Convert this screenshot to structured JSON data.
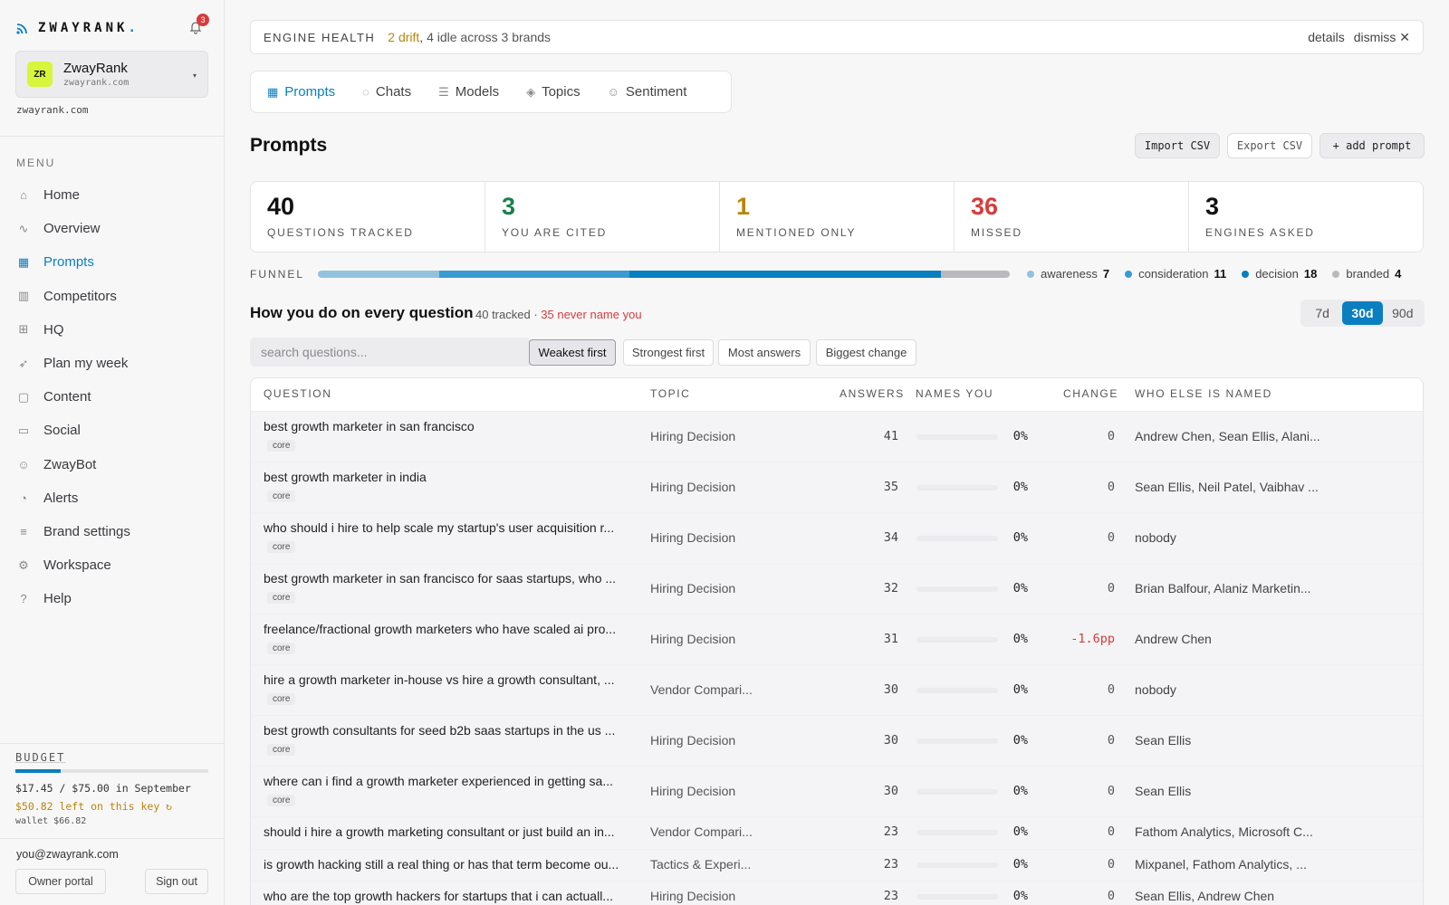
{
  "app": {
    "logo_text": "ZWAYRANK",
    "logo_dot": ".",
    "notifications_count": "3"
  },
  "brand": {
    "initials": "ZR",
    "name": "ZwayRank",
    "domain": "zwayrank.com",
    "domain_under": "zwayrank.com",
    "caret": "▾"
  },
  "sidebar": {
    "menu_label": "MENU",
    "items": [
      {
        "label": "Home",
        "icon": "home-icon",
        "glyph": "⌂"
      },
      {
        "label": "Overview",
        "icon": "pulse-icon",
        "glyph": "∿"
      },
      {
        "label": "Prompts",
        "icon": "grid-icon",
        "glyph": "▦"
      },
      {
        "label": "Competitors",
        "icon": "bar-chart-icon",
        "glyph": "▥"
      },
      {
        "label": "HQ",
        "icon": "dashboard-icon",
        "glyph": "⊞"
      },
      {
        "label": "Plan my week",
        "icon": "rocket-icon",
        "glyph": "➶"
      },
      {
        "label": "Content",
        "icon": "document-icon",
        "glyph": "▢"
      },
      {
        "label": "Social",
        "icon": "chat-icon",
        "glyph": "▭"
      },
      {
        "label": "ZwayBot",
        "icon": "bot-icon",
        "glyph": "☺"
      },
      {
        "label": "Alerts",
        "icon": "bell-icon",
        "glyph": "◔"
      },
      {
        "label": "Brand settings",
        "icon": "sliders-icon",
        "glyph": "≡"
      },
      {
        "label": "Workspace",
        "icon": "gear-icon",
        "glyph": "⚙"
      },
      {
        "label": "Help",
        "icon": "help-icon",
        "glyph": "?"
      }
    ],
    "active_index": 2
  },
  "budget": {
    "label": "BUDGET",
    "spent_fraction": 0.233,
    "line1": "$17.45 / $75.00 in September",
    "line2": "$50.82 left on this key ↻",
    "line3": "wallet $66.82"
  },
  "account": {
    "email": "you@zwayrank.com",
    "owner_portal": "Owner portal",
    "sign_out": "Sign out"
  },
  "health": {
    "label": "ENGINE HEALTH",
    "drift": "2 drift",
    "rest": ", 4 idle across 3 brands",
    "details": "details",
    "dismiss": "dismiss"
  },
  "tabs": [
    {
      "label": "Prompts",
      "icon": "grid-icon",
      "glyph": "▦"
    },
    {
      "label": "Chats",
      "icon": "chat-icon",
      "glyph": "◌"
    },
    {
      "label": "Models",
      "icon": "list-icon",
      "glyph": "☰"
    },
    {
      "label": "Topics",
      "icon": "layers-icon",
      "glyph": "◈"
    },
    {
      "label": "Sentiment",
      "icon": "smile-icon",
      "glyph": "☺"
    }
  ],
  "page": {
    "title": "Prompts",
    "import_csv": "Import CSV",
    "export_csv": "Export CSV",
    "add_prompt": "+ add prompt"
  },
  "stats": [
    {
      "value": "40",
      "label": "QUESTIONS TRACKED",
      "color": "#111111"
    },
    {
      "value": "3",
      "label": "YOU ARE CITED",
      "color": "#1a7f4e"
    },
    {
      "value": "1",
      "label": "MENTIONED ONLY",
      "color": "#b8860b"
    },
    {
      "value": "36",
      "label": "MISSED",
      "color": "#d83b3b"
    },
    {
      "value": "3",
      "label": "ENGINES ASKED",
      "color": "#111111"
    }
  ],
  "funnel": {
    "label": "FUNNEL",
    "segments": [
      {
        "name": "awareness",
        "count": 7,
        "color": "#92c2dd"
      },
      {
        "name": "consideration",
        "count": 11,
        "color": "#3a9ad1"
      },
      {
        "name": "decision",
        "count": 18,
        "color": "#0a7fbf"
      },
      {
        "name": "branded",
        "count": 4,
        "color": "#b9b9be"
      }
    ]
  },
  "section": {
    "title": "How you do on every question",
    "tracked": "40 tracked · ",
    "never": "35 never name you"
  },
  "range": {
    "options": [
      "7d",
      "30d",
      "90d"
    ],
    "active": "30d"
  },
  "search": {
    "placeholder": "search questions..."
  },
  "sorts": [
    "Weakest first",
    "Strongest first",
    "Most answers",
    "Biggest change"
  ],
  "table": {
    "headers": {
      "question": "QUESTION",
      "topic": "TOPIC",
      "answers": "ANSWERS",
      "names_you": "NAMES YOU",
      "change": "CHANGE",
      "who": "WHO ELSE IS NAMED"
    },
    "rows": [
      {
        "q": "best growth marketer in san francisco",
        "tag": "core",
        "topic": "Hiring Decision",
        "answers": "41",
        "pct": "0%",
        "change": "0",
        "who": "Andrew Chen, Sean Ellis, Alani..."
      },
      {
        "q": "best growth marketer in india",
        "tag": "core",
        "topic": "Hiring Decision",
        "answers": "35",
        "pct": "0%",
        "change": "0",
        "who": "Sean Ellis, Neil Patel, Vaibhav ..."
      },
      {
        "q": "who should i hire to help scale my startup's user acquisition r...",
        "tag": "core",
        "topic": "Hiring Decision",
        "answers": "34",
        "pct": "0%",
        "change": "0",
        "who": "nobody"
      },
      {
        "q": "best growth marketer in san francisco for saas startups, who ...",
        "tag": "core",
        "topic": "Hiring Decision",
        "answers": "32",
        "pct": "0%",
        "change": "0",
        "who": "Brian Balfour, Alaniz Marketin..."
      },
      {
        "q": "freelance/fractional growth marketers who have scaled ai pro...",
        "tag": "core",
        "topic": "Hiring Decision",
        "answers": "31",
        "pct": "0%",
        "change": "-1.6pp",
        "who": "Andrew Chen"
      },
      {
        "q": "hire a growth marketer in-house vs hire a growth consultant, ...",
        "tag": "core",
        "topic": "Vendor Compari...",
        "answers": "30",
        "pct": "0%",
        "change": "0",
        "who": "nobody"
      },
      {
        "q": "best growth consultants for seed b2b saas startups in the us ...",
        "tag": "core",
        "topic": "Hiring Decision",
        "answers": "30",
        "pct": "0%",
        "change": "0",
        "who": "Sean Ellis"
      },
      {
        "q": "where can i find a growth marketer experienced in getting sa...",
        "tag": "core",
        "topic": "Hiring Decision",
        "answers": "30",
        "pct": "0%",
        "change": "0",
        "who": "Sean Ellis"
      },
      {
        "q": "should i hire a growth marketing consultant or just build an in...",
        "tag": "",
        "topic": "Vendor Compari...",
        "answers": "23",
        "pct": "0%",
        "change": "0",
        "who": "Fathom Analytics, Microsoft C..."
      },
      {
        "q": "is growth hacking still a real thing or has that term become ou...",
        "tag": "",
        "topic": "Tactics & Experi...",
        "answers": "23",
        "pct": "0%",
        "change": "0",
        "who": "Mixpanel, Fathom Analytics, ..."
      },
      {
        "q": "who are the top growth hackers for startups that i can actuall...",
        "tag": "",
        "topic": "Hiring Decision",
        "answers": "23",
        "pct": "0%",
        "change": "0",
        "who": "Sean Ellis, Andrew Chen"
      }
    ]
  }
}
